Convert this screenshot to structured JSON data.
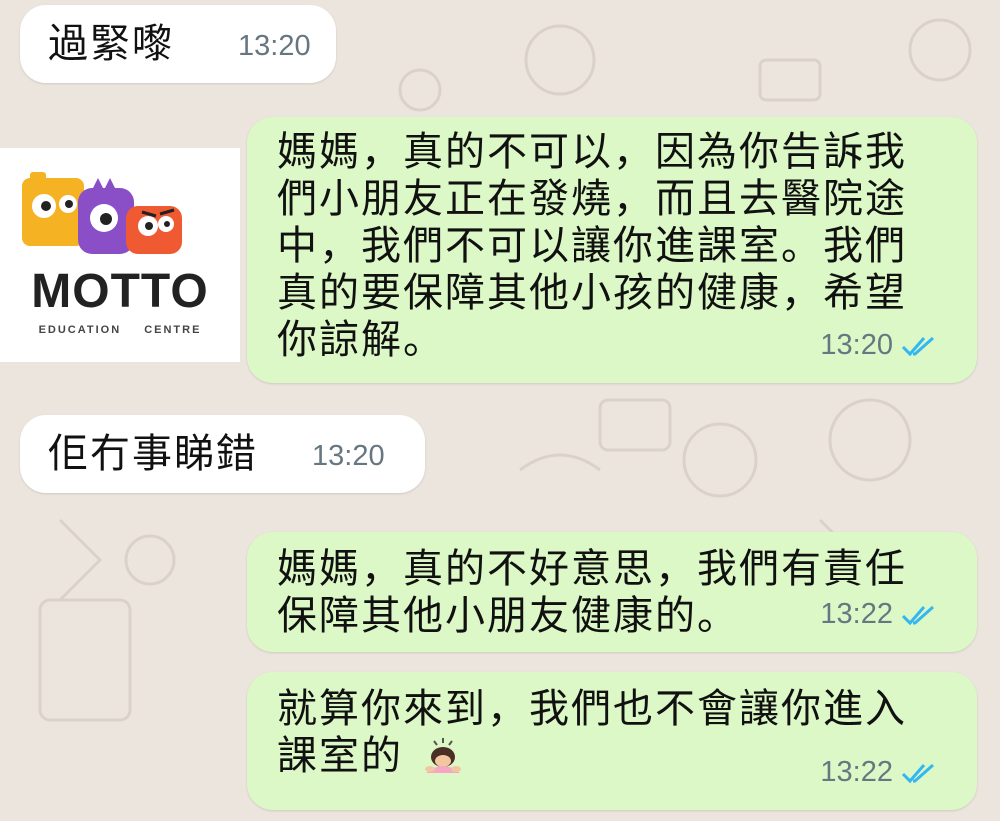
{
  "messages": [
    {
      "direction": "incoming",
      "text": "過緊嚟",
      "time": "13:20"
    },
    {
      "direction": "outgoing",
      "lines": [
        "媽媽，真的不可以，因為你告訴我",
        "們小朋友正在發燒，而且去醫院途",
        "中，我們不可以讓你進課室。我們",
        "真的要保障其他小孩的健康，希望",
        "你諒解。"
      ],
      "time": "13:20",
      "status": "read-double-check-icon"
    },
    {
      "direction": "incoming",
      "text": "佢冇事睇錯",
      "time": "13:20"
    },
    {
      "direction": "outgoing",
      "lines": [
        "媽媽，真的不好意思，我們有責任",
        "保障其他小朋友健康的。"
      ],
      "time": "13:22",
      "status": "read-double-check-icon"
    },
    {
      "direction": "outgoing",
      "lines": [
        "就算你來到，我們也不會讓你進入",
        "課室的"
      ],
      "emoji": "person-bowing-emoji",
      "time": "13:22",
      "status": "read-double-check-icon"
    }
  ],
  "logo": {
    "name": "MOTTO",
    "subtitle": "EDUCATION CENTRE"
  },
  "colors": {
    "chat_bg": "#ece5dd",
    "incoming_bubble": "#ffffff",
    "outgoing_bubble": "#dcf8c6",
    "read_ticks": "#34b7f1",
    "timestamp": "#667781"
  }
}
